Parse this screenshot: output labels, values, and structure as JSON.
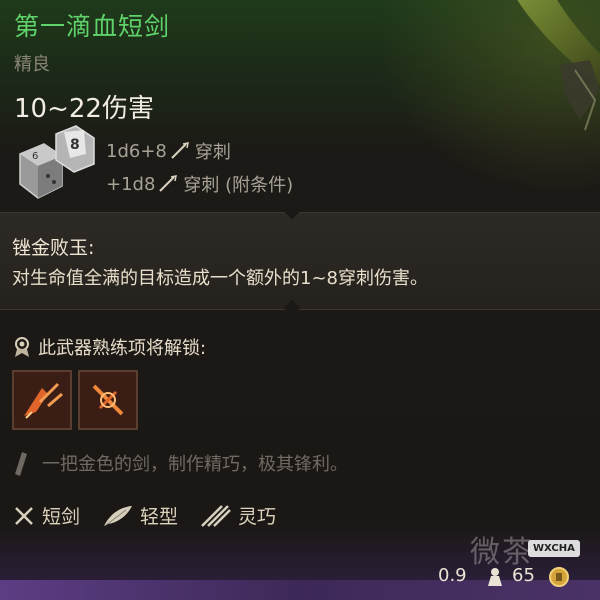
{
  "item": {
    "name": "第一滴血短剑",
    "rarity": "精良",
    "damage_total": "10~22伤害",
    "damage_lines": [
      {
        "dice": "1d6+8",
        "type": "穿刺"
      },
      {
        "dice": "+1d8",
        "type": "穿刺 (附条件)"
      }
    ]
  },
  "passive": {
    "name": "锉金败玉:",
    "description": "对生命值全满的目标造成一个额外的1~8穿刺伤害。"
  },
  "proficiency": {
    "label": "此武器熟练项将解锁:"
  },
  "flavor": "一把金色的剑，制作精巧，极其锋利。",
  "properties": [
    {
      "icon": "dagger-icon",
      "label": "短剑"
    },
    {
      "icon": "feather-icon",
      "label": "轻型"
    },
    {
      "icon": "finesse-icon",
      "label": "灵巧"
    }
  ],
  "footer": {
    "weight": "0.9",
    "price": "65"
  },
  "watermark": {
    "text": "微茶",
    "badge": "WXCHA"
  },
  "colors": {
    "title": "#5fd36a",
    "rarity": "#8a8476",
    "text": "#e8dfcb",
    "muted": "#6f6a62",
    "footer_purple": "#4a3266"
  }
}
